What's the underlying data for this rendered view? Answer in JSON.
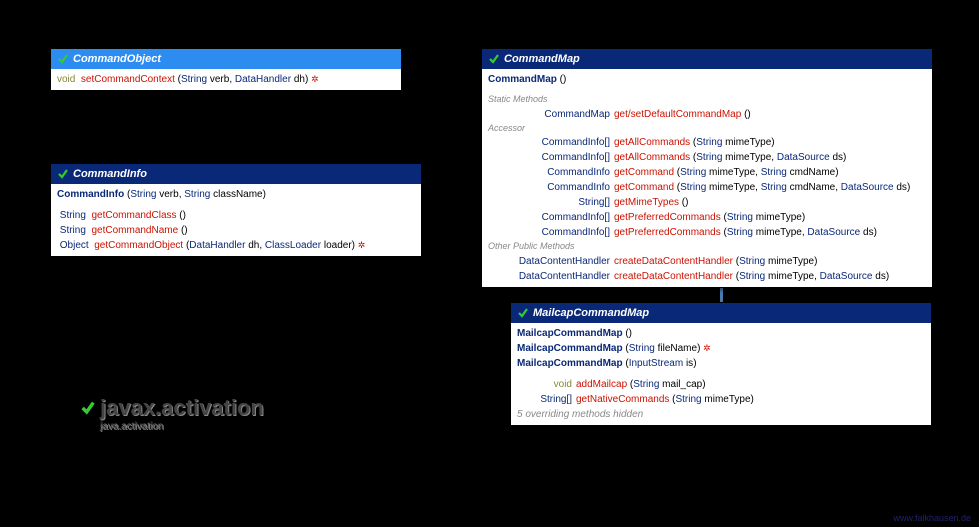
{
  "package": {
    "title": "javax.activation",
    "subtitle": "java.activation"
  },
  "credit": "www.falkhausen.de",
  "commandObject": {
    "title": "CommandObject",
    "m1_ret": "void",
    "m1_name": "setCommandContext",
    "m1_p1t": "String",
    "m1_p1n": "verb",
    "m1_p2t": "DataHandler",
    "m1_p2n": "dh",
    "m1_exc": "✲"
  },
  "commandInfo": {
    "title": "CommandInfo",
    "ctor_name": "CommandInfo",
    "ctor_p1t": "String",
    "ctor_p1n": "verb",
    "ctor_p2t": "String",
    "ctor_p2n": "className",
    "m1_ret": "String",
    "m1_name": "getCommandClass",
    "m2_ret": "String",
    "m2_name": "getCommandName",
    "m3_ret": "Object",
    "m3_name": "getCommandObject",
    "m3_p1t": "DataHandler",
    "m3_p1n": "dh",
    "m3_p2t": "ClassLoader",
    "m3_p2n": "loader",
    "m3_exc": "✲"
  },
  "commandMap": {
    "title": "CommandMap",
    "ctor_name": "CommandMap",
    "sec1": "Static Methods",
    "s1_ret": "CommandMap",
    "s1_name": "get/setDefaultCommandMap",
    "sec2": "Accessor",
    "a1_ret": "CommandInfo[]",
    "a1_name": "getAllCommands",
    "a1_p1t": "String",
    "a1_p1n": "mimeType",
    "a2_ret": "CommandInfo[]",
    "a2_name": "getAllCommands",
    "a2_p1t": "String",
    "a2_p1n": "mimeType",
    "a2_p2t": "DataSource",
    "a2_p2n": "ds",
    "a3_ret": "CommandInfo",
    "a3_name": "getCommand",
    "a3_p1t": "String",
    "a3_p1n": "mimeType",
    "a3_p2t": "String",
    "a3_p2n": "cmdName",
    "a4_ret": "CommandInfo",
    "a4_name": "getCommand",
    "a4_p1t": "String",
    "a4_p1n": "mimeType",
    "a4_p2t": "String",
    "a4_p2n": "cmdName",
    "a4_p3t": "DataSource",
    "a4_p3n": "ds",
    "a5_ret": "String[]",
    "a5_name": "getMimeTypes",
    "a6_ret": "CommandInfo[]",
    "a6_name": "getPreferredCommands",
    "a6_p1t": "String",
    "a6_p1n": "mimeType",
    "a7_ret": "CommandInfo[]",
    "a7_name": "getPreferredCommands",
    "a7_p1t": "String",
    "a7_p1n": "mimeType",
    "a7_p2t": "DataSource",
    "a7_p2n": "ds",
    "sec3": "Other Public Methods",
    "o1_ret": "DataContentHandler",
    "o1_name": "createDataContentHandler",
    "o1_p1t": "String",
    "o1_p1n": "mimeType",
    "o2_ret": "DataContentHandler",
    "o2_name": "createDataContentHandler",
    "o2_p1t": "String",
    "o2_p1n": "mimeType",
    "o2_p2t": "DataSource",
    "o2_p2n": "ds"
  },
  "mailcap": {
    "title": "MailcapCommandMap",
    "ctor1_name": "MailcapCommandMap",
    "ctor2_name": "MailcapCommandMap",
    "ctor2_p1t": "String",
    "ctor2_p1n": "fileName",
    "ctor2_exc": "✲",
    "ctor3_name": "MailcapCommandMap",
    "ctor3_p1t": "InputStream",
    "ctor3_p1n": "is",
    "m1_ret": "void",
    "m1_name": "addMailcap",
    "m1_p1t": "String",
    "m1_p1n": "mail_cap",
    "m2_ret": "String[]",
    "m2_name": "getNativeCommands",
    "m2_p1t": "String",
    "m2_p1n": "mimeType",
    "hidden": "5 overriding methods hidden"
  }
}
